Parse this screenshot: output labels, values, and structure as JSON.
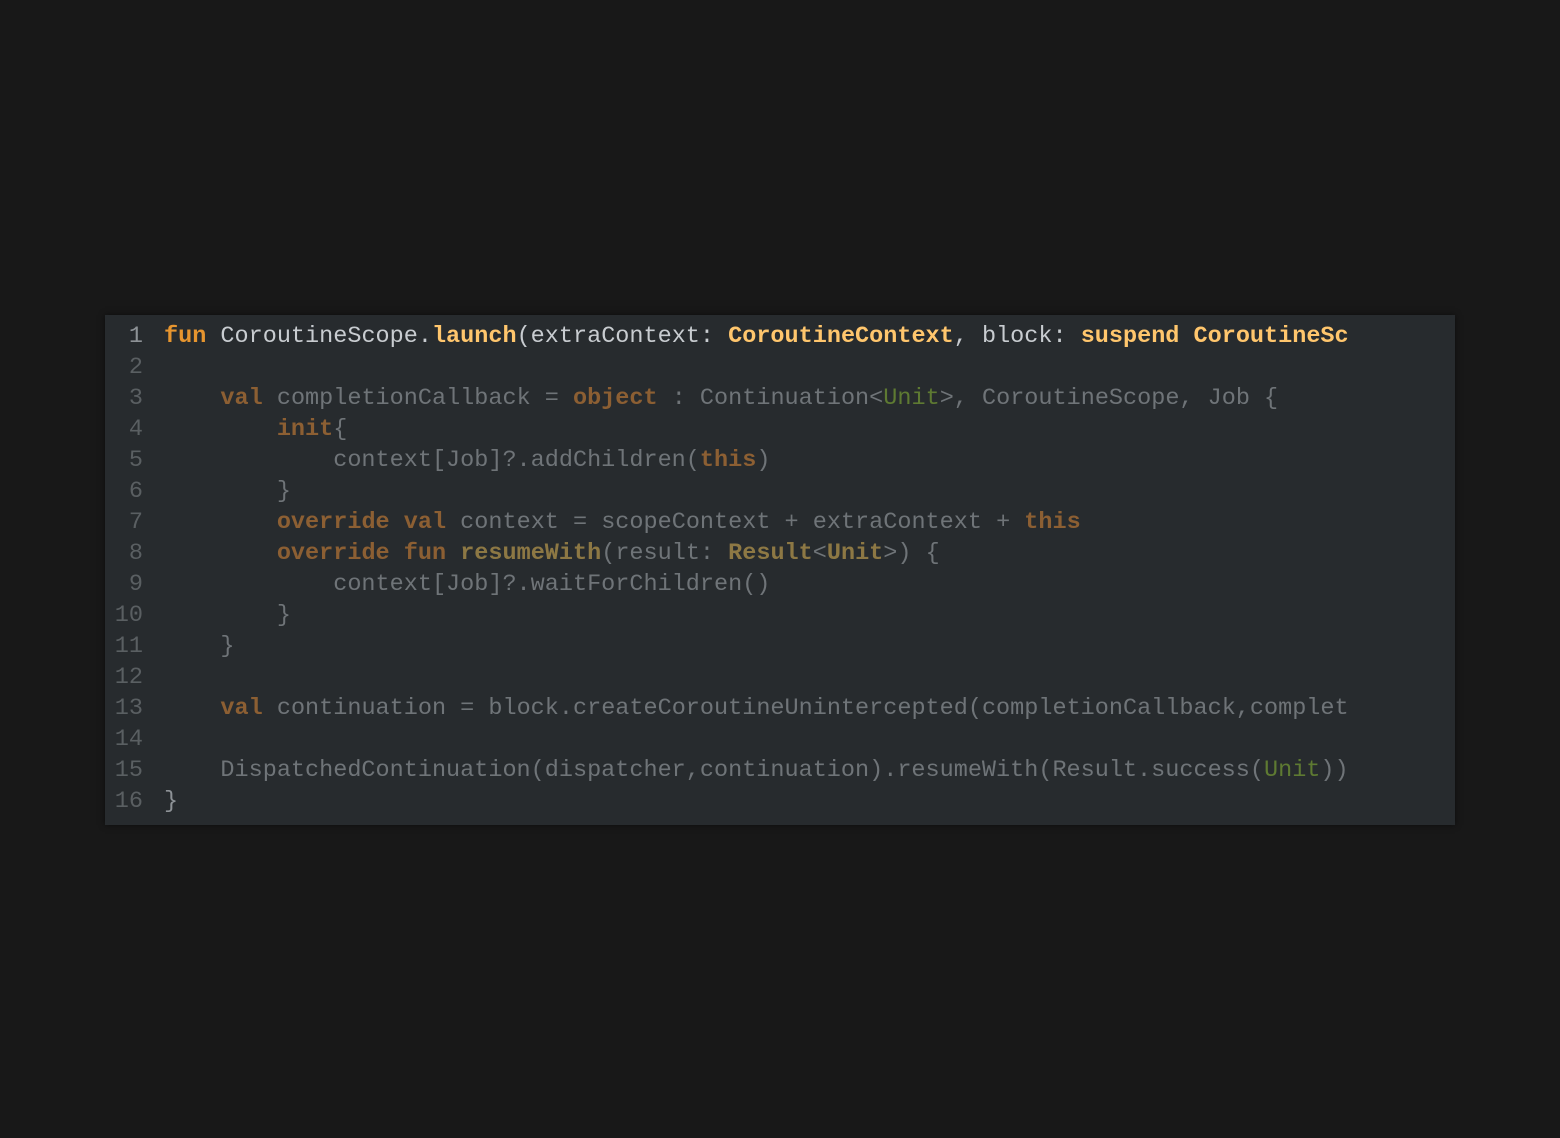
{
  "editor": {
    "lines": [
      {
        "num": "1",
        "tokens": [
          {
            "t": "fun",
            "c": "#e6952f",
            "b": true
          },
          {
            "t": " CoroutineScope.",
            "c": "#c8ccd0"
          },
          {
            "t": "launch",
            "c": "#ffc66d",
            "b": true
          },
          {
            "t": "(extraContext: ",
            "c": "#c8ccd0"
          },
          {
            "t": "CoroutineContext",
            "c": "#ffc66d",
            "b": true
          },
          {
            "t": ", block: ",
            "c": "#c8ccd0"
          },
          {
            "t": "suspend",
            "c": "#ffc66d",
            "b": true
          },
          {
            "t": " ",
            "c": "#c8ccd0"
          },
          {
            "t": "CoroutineSc",
            "c": "#ffc66d",
            "b": true
          }
        ]
      },
      {
        "num": "2",
        "tokens": []
      },
      {
        "num": "3",
        "tokens": [
          {
            "t": "    ",
            "c": "#6f7478"
          },
          {
            "t": "val",
            "c": "#8c5f33",
            "b": true
          },
          {
            "t": " completionCallback = ",
            "c": "#6f7478"
          },
          {
            "t": "object",
            "c": "#8c5f33",
            "b": true
          },
          {
            "t": " : Continuation<",
            "c": "#6f7478"
          },
          {
            "t": "Unit",
            "c": "#5e7a32"
          },
          {
            "t": ">, CoroutineScope, Job {",
            "c": "#6f7478"
          }
        ]
      },
      {
        "num": "4",
        "tokens": [
          {
            "t": "        ",
            "c": "#6f7478"
          },
          {
            "t": "init",
            "c": "#8c5f33",
            "b": true
          },
          {
            "t": "{",
            "c": "#6f7478"
          }
        ]
      },
      {
        "num": "5",
        "tokens": [
          {
            "t": "            context[Job]?.addChildren(",
            "c": "#6f7478"
          },
          {
            "t": "this",
            "c": "#8c5f33",
            "b": true
          },
          {
            "t": ")",
            "c": "#6f7478"
          }
        ]
      },
      {
        "num": "6",
        "tokens": [
          {
            "t": "        }",
            "c": "#6f7478"
          }
        ]
      },
      {
        "num": "7",
        "tokens": [
          {
            "t": "        ",
            "c": "#6f7478"
          },
          {
            "t": "override",
            "c": "#8c5f33",
            "b": true
          },
          {
            "t": " ",
            "c": "#6f7478"
          },
          {
            "t": "val",
            "c": "#8c5f33",
            "b": true
          },
          {
            "t": " context = scopeContext + extraContext + ",
            "c": "#6f7478"
          },
          {
            "t": "this",
            "c": "#8c5f33",
            "b": true
          }
        ]
      },
      {
        "num": "8",
        "tokens": [
          {
            "t": "        ",
            "c": "#6f7478"
          },
          {
            "t": "override",
            "c": "#8c5f33",
            "b": true
          },
          {
            "t": " ",
            "c": "#6f7478"
          },
          {
            "t": "fun",
            "c": "#8c5f33",
            "b": true
          },
          {
            "t": " ",
            "c": "#6f7478"
          },
          {
            "t": "resumeWith",
            "c": "#8d7844",
            "b": true
          },
          {
            "t": "(result: ",
            "c": "#6f7478"
          },
          {
            "t": "Result",
            "c": "#8d7844",
            "b": true
          },
          {
            "t": "<",
            "c": "#6f7478"
          },
          {
            "t": "Unit",
            "c": "#8d7844",
            "b": true
          },
          {
            "t": ">) {",
            "c": "#6f7478"
          }
        ]
      },
      {
        "num": "9",
        "tokens": [
          {
            "t": "            context[Job]?.waitForChildren()",
            "c": "#6f7478"
          }
        ]
      },
      {
        "num": "10",
        "tokens": [
          {
            "t": "        }",
            "c": "#6f7478"
          }
        ]
      },
      {
        "num": "11",
        "tokens": [
          {
            "t": "    }",
            "c": "#6f7478"
          }
        ]
      },
      {
        "num": "12",
        "tokens": []
      },
      {
        "num": "13",
        "tokens": [
          {
            "t": "    ",
            "c": "#6f7478"
          },
          {
            "t": "val",
            "c": "#8c5f33",
            "b": true
          },
          {
            "t": " continuation = block.createCoroutineUnintercepted(completionCallback,complet",
            "c": "#6f7478"
          }
        ]
      },
      {
        "num": "14",
        "tokens": []
      },
      {
        "num": "15",
        "tokens": [
          {
            "t": "    DispatchedContinuation(dispatcher,continuation).resumeWith(Result.success(",
            "c": "#6f7478"
          },
          {
            "t": "Unit",
            "c": "#5e7a32"
          },
          {
            "t": "))",
            "c": "#6f7478"
          }
        ]
      },
      {
        "num": "16",
        "tokens": [
          {
            "t": "}",
            "c": "#8d9296"
          }
        ]
      }
    ]
  }
}
